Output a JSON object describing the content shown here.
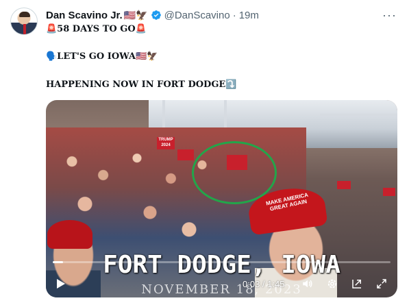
{
  "tweet": {
    "author_name": "Dan Scavino Jr.",
    "author_emoji": "🇺🇸🦅",
    "handle": "@DanScavino",
    "separator": "·",
    "time_ago": "19m",
    "more_label": "···",
    "lines": [
      "🚨58 DAYS TO GO🚨",
      "🗣️LET'S GO IOWA🇺🇸🦅",
      "HAPPENING NOW IN FORT DODGE⤵️"
    ]
  },
  "video": {
    "overlay_title": "FORT DODGE, IOWA",
    "overlay_date": "NOVEMBER 18, 2023",
    "hat_text": "MAKE AMERICA GREAT AGAIN",
    "sign_text": "TRUMP 2024",
    "current_time": "0:03",
    "duration": "1:45",
    "time_separator": " / ",
    "progress_fraction": 0.03
  },
  "colors": {
    "verified_badge": "#1d9bf0",
    "annotation_circle": "#22a64a",
    "maga_red": "#c4161c"
  },
  "icons": {
    "play": "play-icon",
    "volume": "volume-icon",
    "settings": "settings-icon",
    "popout": "popout-icon",
    "fullscreen": "fullscreen-icon"
  }
}
